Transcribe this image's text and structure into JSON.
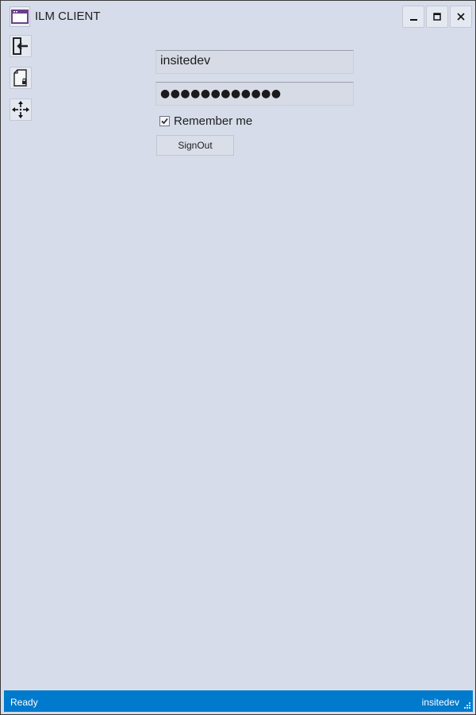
{
  "window": {
    "title": "ILM CLIENT",
    "icon": "app-window-icon",
    "controls": [
      "minimize-icon",
      "maximize-icon",
      "close-icon"
    ]
  },
  "toolbar": {
    "items": [
      {
        "name": "sign-out",
        "icon": "sign-out-icon"
      },
      {
        "name": "lock-document",
        "icon": "locked-document-icon"
      },
      {
        "name": "move",
        "icon": "move-arrows-icon"
      }
    ]
  },
  "login": {
    "username": "insitedev",
    "password_masked": "●●●●●●●●●●●●",
    "remember_label": "Remember me",
    "remember_checked": true,
    "signout_label": "SignOut"
  },
  "status": {
    "left": "Ready",
    "right": "insitedev"
  },
  "colors": {
    "background": "#d6dce9",
    "statusbar": "#007acc",
    "accent_icon": "#6b3f8a"
  }
}
